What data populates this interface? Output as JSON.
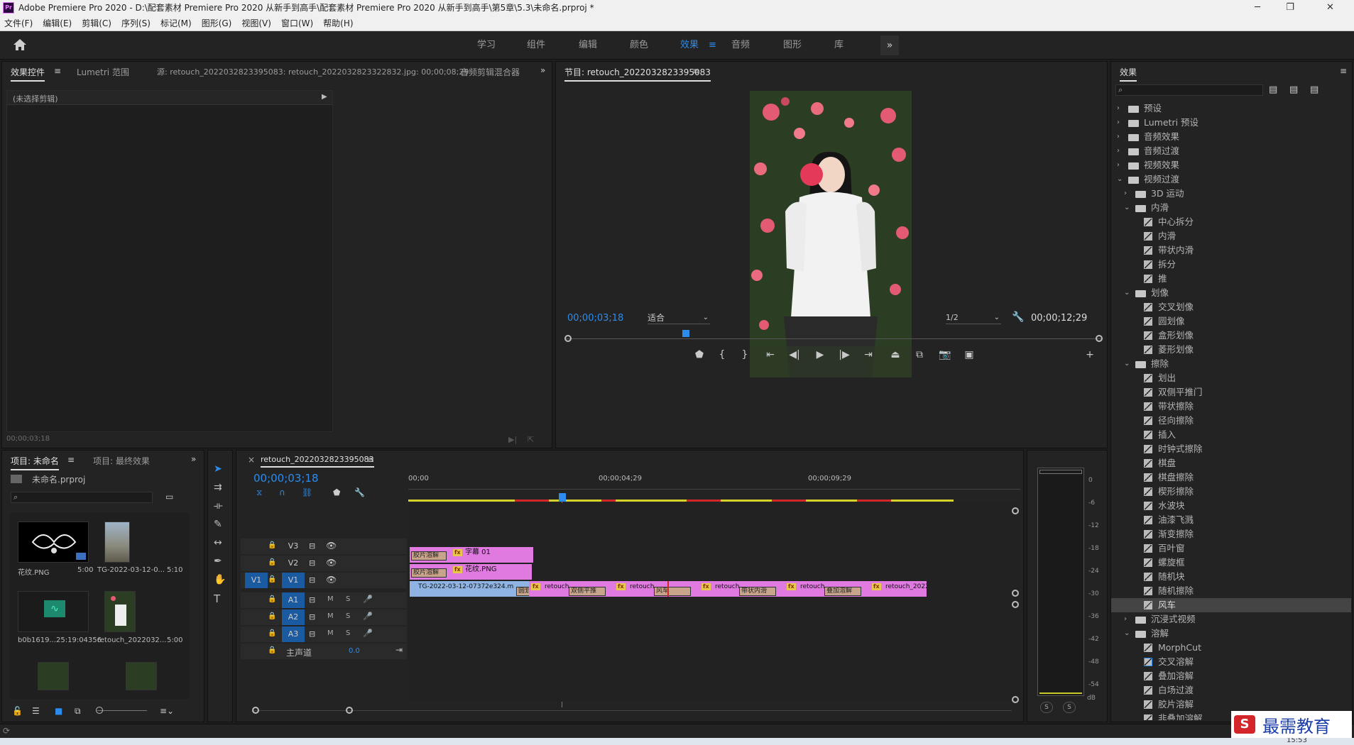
{
  "app": {
    "title": "Adobe Premiere Pro 2020 - D:\\配套素材 Premiere Pro 2020 从新手到高手\\配套素材 Premiere Pro 2020 从新手到高手\\第5章\\5.3\\未命名.prproj *",
    "icon": "Pr"
  },
  "menu": [
    "文件(F)",
    "编辑(E)",
    "剪辑(C)",
    "序列(S)",
    "标记(M)",
    "图形(G)",
    "视图(V)",
    "窗口(W)",
    "帮助(H)"
  ],
  "workspaces": {
    "tabs": [
      "学习",
      "组件",
      "编辑",
      "颜色",
      "效果",
      "音频",
      "图形",
      "库"
    ],
    "active": "效果",
    "more": "»"
  },
  "source_panel": {
    "tabs": [
      "效果控件",
      "Lumetri 范围",
      "源: retouch_2022032823395083: retouch_2022032823322832.jpg: 00;00;08;29",
      "音频剪辑混合器"
    ],
    "no_clip": "(未选择剪辑)",
    "timecode": "00;00;03;18"
  },
  "program_monitor": {
    "title": "节目: retouch_2022032823395083",
    "timecode": "00;00;03;18",
    "fit": "适合",
    "resolution": "1/2",
    "duration": "00;00;12;29"
  },
  "effects_panel": {
    "title": "效果",
    "items": [
      {
        "label": "预设",
        "level": 0,
        "type": "folder",
        "open": false,
        "star": true
      },
      {
        "label": "Lumetri 预设",
        "level": 0,
        "type": "folder",
        "open": false,
        "star": true
      },
      {
        "label": "音频效果",
        "level": 0,
        "type": "folder",
        "open": false
      },
      {
        "label": "音频过渡",
        "level": 0,
        "type": "folder",
        "open": false
      },
      {
        "label": "视频效果",
        "level": 0,
        "type": "folder",
        "open": false
      },
      {
        "label": "视频过渡",
        "level": 0,
        "type": "folder",
        "open": true
      },
      {
        "label": "3D 运动",
        "level": 1,
        "type": "folder",
        "open": false
      },
      {
        "label": "内滑",
        "level": 1,
        "type": "folder",
        "open": true
      },
      {
        "label": "中心拆分",
        "level": 2,
        "type": "fx"
      },
      {
        "label": "内滑",
        "level": 2,
        "type": "fx"
      },
      {
        "label": "带状内滑",
        "level": 2,
        "type": "fx"
      },
      {
        "label": "拆分",
        "level": 2,
        "type": "fx"
      },
      {
        "label": "推",
        "level": 2,
        "type": "fx"
      },
      {
        "label": "划像",
        "level": 1,
        "type": "folder",
        "open": true
      },
      {
        "label": "交叉划像",
        "level": 2,
        "type": "fx"
      },
      {
        "label": "圆划像",
        "level": 2,
        "type": "fx"
      },
      {
        "label": "盒形划像",
        "level": 2,
        "type": "fx"
      },
      {
        "label": "菱形划像",
        "level": 2,
        "type": "fx"
      },
      {
        "label": "擦除",
        "level": 1,
        "type": "folder",
        "open": true
      },
      {
        "label": "划出",
        "level": 2,
        "type": "fx"
      },
      {
        "label": "双侧平推门",
        "level": 2,
        "type": "fx"
      },
      {
        "label": "带状擦除",
        "level": 2,
        "type": "fx"
      },
      {
        "label": "径向擦除",
        "level": 2,
        "type": "fx"
      },
      {
        "label": "插入",
        "level": 2,
        "type": "fx"
      },
      {
        "label": "时钟式擦除",
        "level": 2,
        "type": "fx"
      },
      {
        "label": "棋盘",
        "level": 2,
        "type": "fx"
      },
      {
        "label": "棋盘擦除",
        "level": 2,
        "type": "fx"
      },
      {
        "label": "楔形擦除",
        "level": 2,
        "type": "fx"
      },
      {
        "label": "水波块",
        "level": 2,
        "type": "fx"
      },
      {
        "label": "油漆飞溅",
        "level": 2,
        "type": "fx"
      },
      {
        "label": "渐变擦除",
        "level": 2,
        "type": "fx"
      },
      {
        "label": "百叶窗",
        "level": 2,
        "type": "fx"
      },
      {
        "label": "螺旋框",
        "level": 2,
        "type": "fx"
      },
      {
        "label": "随机块",
        "level": 2,
        "type": "fx"
      },
      {
        "label": "随机擦除",
        "level": 2,
        "type": "fx"
      },
      {
        "label": "风车",
        "level": 2,
        "type": "fx",
        "selected": true
      },
      {
        "label": "沉浸式视频",
        "level": 1,
        "type": "folder",
        "open": false
      },
      {
        "label": "溶解",
        "level": 1,
        "type": "folder",
        "open": true
      },
      {
        "label": "MorphCut",
        "level": 2,
        "type": "fx"
      },
      {
        "label": "交叉溶解",
        "level": 2,
        "type": "fx",
        "boxed": true
      },
      {
        "label": "叠加溶解",
        "level": 2,
        "type": "fx"
      },
      {
        "label": "白场过渡",
        "level": 2,
        "type": "fx"
      },
      {
        "label": "胶片溶解",
        "level": 2,
        "type": "fx"
      },
      {
        "label": "非叠加溶解",
        "level": 2,
        "type": "fx"
      }
    ]
  },
  "project_panel": {
    "tabs": [
      "项目: 未命名",
      "项目: 最终效果"
    ],
    "file": "未命名.prproj",
    "items": [
      {
        "name": "花纹.PNG",
        "duration": "5:00"
      },
      {
        "name": "TG-2022-03-12-0...",
        "duration": "5:10"
      },
      {
        "name": "b0b1619...",
        "duration": "25:19:04356"
      },
      {
        "name": "retouch_2022032...",
        "duration": "5:00"
      }
    ]
  },
  "timeline": {
    "title": "retouch_2022032823395083",
    "timecode": "00;00;03;18",
    "ruler": [
      "00;00",
      "00;00;04;29",
      "00;00;09;29"
    ],
    "tracks": [
      "V3",
      "V2",
      "V1",
      "A1",
      "A2",
      "A3"
    ],
    "master_label": "主声道",
    "master_value": "0.0",
    "clips": {
      "v3": {
        "transition": "胶片溶解",
        "fx": "fx",
        "name": "字幕 01"
      },
      "v2": {
        "transition": "胶片溶解",
        "fx": "fx",
        "name": "花纹.PNG"
      },
      "v1": [
        {
          "name": "TG-2022-03-12-07372e324.m",
          "transition": "圆划像"
        },
        {
          "name": "retouch_",
          "transition": "双侧平推"
        },
        {
          "name": "retouch_",
          "transition": "风车"
        },
        {
          "name": "retouch_",
          "transition": "带状内滑"
        },
        {
          "name": "retouch_",
          "transition": "叠加溶解"
        },
        {
          "name": "retouch_20220"
        }
      ]
    }
  },
  "audio_meter": {
    "scale": [
      "0",
      "-6",
      "-12",
      "-18",
      "-24",
      "-30",
      "-36",
      "-42",
      "-48",
      "-54",
      "dB"
    ],
    "solo": "S"
  },
  "watermark": {
    "text": "最需教育"
  },
  "taskbar": {
    "clock": "15:53"
  },
  "colors": {
    "accent": "#2d8ceb",
    "clip_pink": "#e079e0",
    "clip_blue": "#8fb4e3",
    "playhead": "#2d8ceb"
  }
}
